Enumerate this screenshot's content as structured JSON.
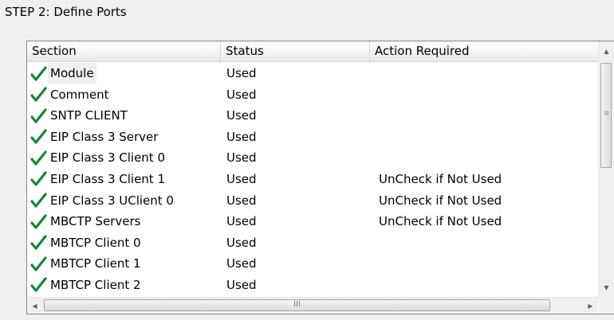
{
  "step_title": "STEP 2: Define Ports",
  "columns": [
    "Section",
    "Status",
    "Action Required"
  ],
  "rows": [
    {
      "section": "Module",
      "status": "Used",
      "action": "",
      "checked": true,
      "selected": true
    },
    {
      "section": "Comment",
      "status": "Used",
      "action": "",
      "checked": true
    },
    {
      "section": "SNTP CLIENT",
      "status": "Used",
      "action": "",
      "checked": true
    },
    {
      "section": "EIP Class 3 Server",
      "status": "Used",
      "action": "",
      "checked": true
    },
    {
      "section": "EIP Class 3 Client 0",
      "status": "Used",
      "action": "",
      "checked": true
    },
    {
      "section": "EIP Class 3 Client 1",
      "status": "Used",
      "action": "UnCheck if Not Used",
      "checked": true
    },
    {
      "section": "EIP Class 3 UClient 0",
      "status": "Used",
      "action": "UnCheck if Not Used",
      "checked": true
    },
    {
      "section": "MBCTP Servers",
      "status": "Used",
      "action": "UnCheck if Not Used",
      "checked": true
    },
    {
      "section": "MBTCP Client 0",
      "status": "Used",
      "action": "",
      "checked": true
    },
    {
      "section": "MBTCP Client 1",
      "status": "Used",
      "action": "",
      "checked": true
    },
    {
      "section": "MBTCP Client 2",
      "status": "Used",
      "action": "",
      "checked": true
    }
  ],
  "check_color": "#14873a",
  "scroll_grip": "≡",
  "hscroll_grip": "III",
  "icons": {
    "check": "checkmark-icon",
    "scroll_up": "arrow-up-icon",
    "scroll_down": "arrow-down-icon",
    "scroll_left": "arrow-left-icon",
    "scroll_right": "arrow-right-icon"
  }
}
